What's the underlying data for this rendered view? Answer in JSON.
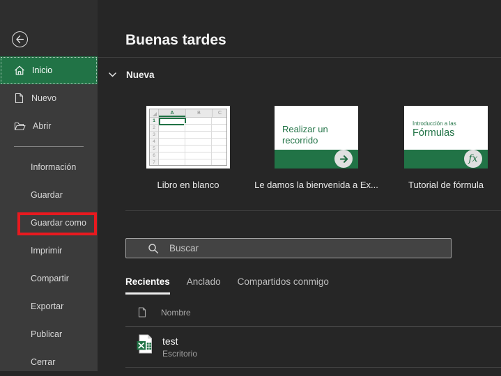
{
  "colors": {
    "accent_green": "#217346",
    "annotation_red": "#e8191f"
  },
  "sidebar": {
    "back_icon": "back-arrow-icon",
    "items": [
      {
        "label": "Inicio",
        "icon": "home-icon",
        "selected": true
      },
      {
        "label": "Nuevo",
        "icon": "new-document-icon"
      },
      {
        "label": "Abrir",
        "icon": "open-folder-icon"
      },
      {
        "label": "Información"
      },
      {
        "label": "Guardar"
      },
      {
        "label": "Guardar como",
        "highlighted_by_red_box": true
      },
      {
        "label": "Imprimir"
      },
      {
        "label": "Compartir"
      },
      {
        "label": "Exportar"
      },
      {
        "label": "Publicar"
      },
      {
        "label": "Cerrar"
      }
    ]
  },
  "main": {
    "greeting": "Buenas tardes",
    "new_section": {
      "title": "Nueva",
      "collapse_icon": "chevron-down-icon",
      "templates": [
        {
          "label": "Libro en blanco",
          "preview": {
            "type": "blank-workbook-grid",
            "columns": [
              "A",
              "B",
              "C"
            ],
            "rows": [
              "1",
              "2",
              "3",
              "4",
              "5",
              "6",
              "7"
            ],
            "selected_cell": "A1"
          }
        },
        {
          "label": "Le damos la bienvenida a Ex...",
          "preview": {
            "line1": "Realizar un",
            "line2": "recorrido",
            "icon": "arrow-right-icon"
          }
        },
        {
          "label": "Tutorial de fórmula",
          "preview": {
            "small_title": "Introducción a las",
            "title": "Fórmulas",
            "fx": "fx"
          }
        }
      ]
    },
    "search": {
      "placeholder": "Buscar",
      "icon": "search-icon"
    },
    "tabs": [
      {
        "label": "Recientes",
        "selected": true
      },
      {
        "label": "Anclado"
      },
      {
        "label": "Compartidos conmigo"
      }
    ],
    "files": {
      "name_column_header": "Nombre",
      "header_icon": "document-icon",
      "rows": [
        {
          "name": "test",
          "location": "Escritorio",
          "icon": "excel-file-icon"
        }
      ]
    }
  }
}
